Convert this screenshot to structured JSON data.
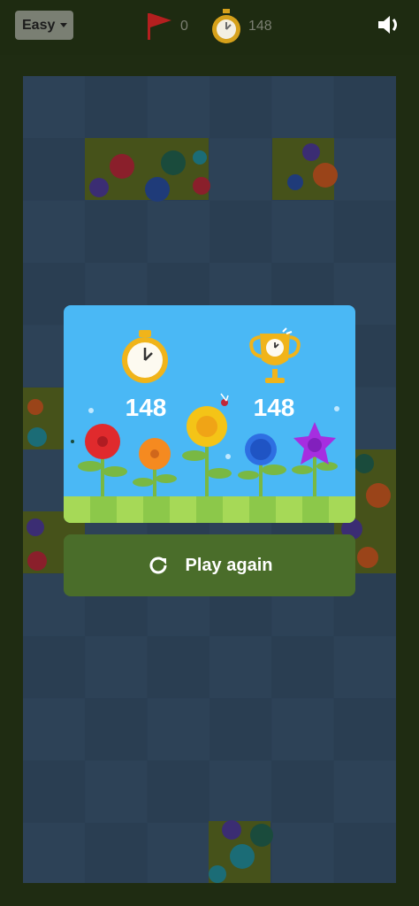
{
  "header": {
    "difficulty_label": "Easy",
    "flags_count": "0",
    "timer_value": "148"
  },
  "result": {
    "time_score": "148",
    "best_score": "148"
  },
  "actions": {
    "play_again_label": "Play again"
  },
  "colors": {
    "card_sky": "#4ab8f5",
    "grass_light": "#a6d957",
    "grass_dark": "#8cc84a",
    "button_green": "#4a6d2a",
    "flag_red": "#b41f1f",
    "timer_gold": "#d6a11b"
  },
  "icons": [
    "caret-down-icon",
    "flag-icon",
    "stopwatch-icon",
    "volume-icon",
    "trophy-icon",
    "refresh-icon"
  ]
}
